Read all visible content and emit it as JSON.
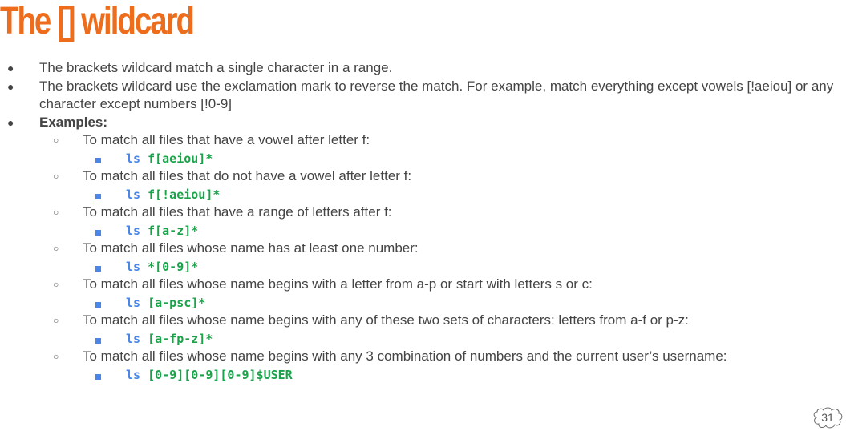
{
  "title": "The [] wildcard",
  "bullets": [
    "The brackets wildcard match a single character in a range.",
    "The brackets wildcard use the exclamation mark to reverse the match. For example, match everything except vowels [!aeiou] or any character except numbers [!0-9]",
    "Examples:"
  ],
  "examples": [
    {
      "desc": "To match all files that have a vowel after letter f:",
      "cmd": "ls",
      "arg": "f[aeiou]*"
    },
    {
      "desc": "To match all files that do not have a vowel after letter f:",
      "cmd": "ls",
      "arg": "f[!aeiou]*"
    },
    {
      "desc": "To match all files that have a range of letters after f:",
      "cmd": "ls",
      "arg": "f[a-z]*"
    },
    {
      "desc": "To match all files whose name has at least one number:",
      "cmd": "ls",
      "arg": "*[0-9]*"
    },
    {
      "desc": "To match all files whose name begins with a letter from a-p or start with letters s or c:",
      "cmd": "ls",
      "arg": "[a-psc]*"
    },
    {
      "desc": "To match all files whose name begins with any of these two sets of characters: letters from a-f or p-z:",
      "cmd": "ls",
      "arg": "[a-fp-z]*"
    },
    {
      "desc": "To match all files whose name begins with any 3 combination of numbers and the current user’s username:",
      "cmd": "ls",
      "arg": "[0-9][0-9][0-9]$USER"
    }
  ],
  "page_number": "31",
  "colors": {
    "title": "#ed6d1c",
    "command": "#4a86e8",
    "argument": "#1aa34a",
    "text": "#444444"
  }
}
